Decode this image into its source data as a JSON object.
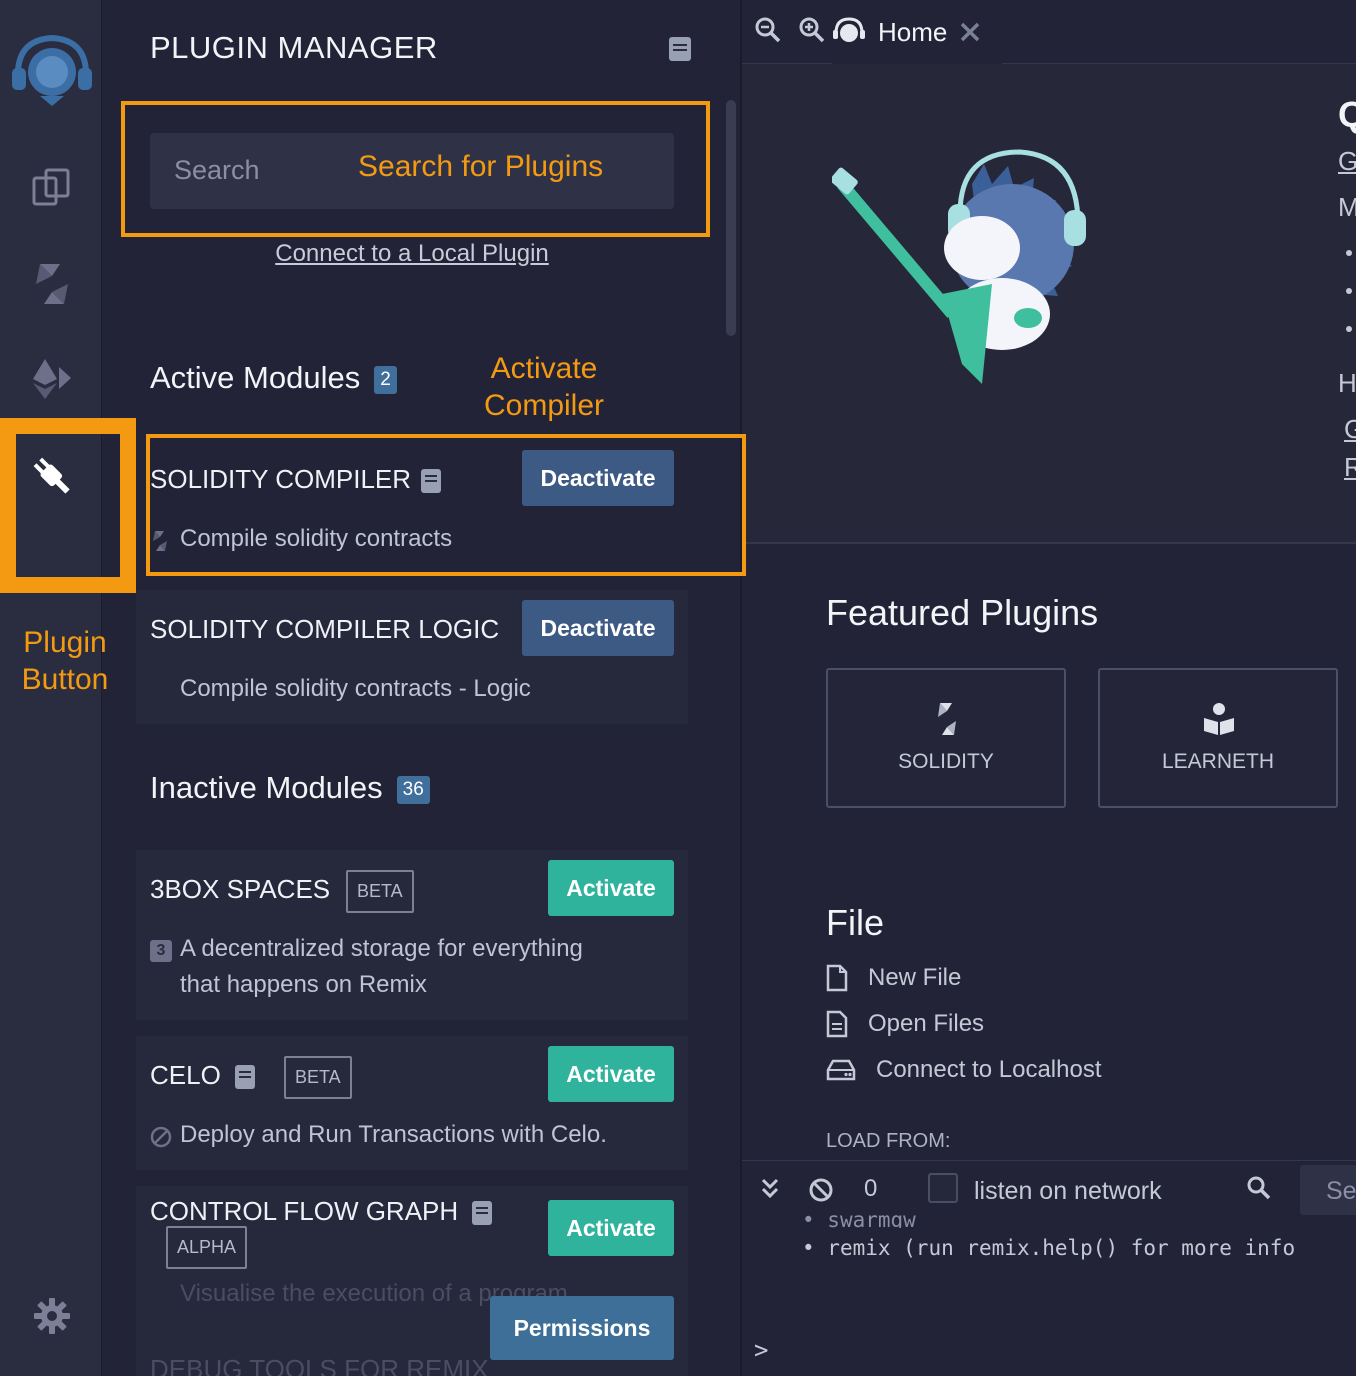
{
  "sidebar": {
    "icons": [
      "remix-logo-icon",
      "file-explorer-icon",
      "solidity-compiler-icon",
      "deploy-run-icon",
      "plugin-icon",
      "settings-icon"
    ]
  },
  "plugin_manager": {
    "title": "PLUGIN MANAGER",
    "search_placeholder": "Search",
    "connect_local_label": "Connect to a Local Plugin",
    "active": {
      "heading": "Active Modules",
      "count": "2",
      "modules": [
        {
          "name": "SOLIDITY COMPILER",
          "description": "Compile solidity contracts",
          "button": "Deactivate"
        },
        {
          "name": "SOLIDITY COMPILER LOGIC",
          "description": "Compile solidity contracts - Logic",
          "button": "Deactivate"
        }
      ]
    },
    "inactive": {
      "heading": "Inactive Modules",
      "count": "36",
      "modules": [
        {
          "name": "3BOX SPACES",
          "tag": "BETA",
          "description_line1": "A decentralized storage for everything",
          "description_line2": "that happens on Remix",
          "button": "Activate"
        },
        {
          "name": "CELO",
          "tag": "BETA",
          "description": "Deploy and Run Transactions with Celo.",
          "button": "Activate"
        },
        {
          "name": "CONTROL FLOW GRAPH",
          "tag": "ALPHA",
          "description": "Visualise the execution of a program",
          "button": "Activate",
          "permissions_button": "Permissions"
        },
        {
          "name": "DEBUG TOOLS FOR REMIX"
        }
      ]
    }
  },
  "home": {
    "tab_label": "Home",
    "hero_letters": {
      "title": "Q",
      "g": "G",
      "m": "M",
      "h": "H",
      "g2": "G",
      "r": "R"
    },
    "featured_title": "Featured Plugins",
    "featured": [
      {
        "label": "SOLIDITY",
        "icon": "solidity-icon"
      },
      {
        "label": "LEARNETH",
        "icon": "book-reader-icon"
      }
    ],
    "file_title": "File",
    "file_items": [
      {
        "label": "New File",
        "icon": "file-icon"
      },
      {
        "label": "Open Files",
        "icon": "file-lines-icon"
      },
      {
        "label": "Connect to Localhost",
        "icon": "hdd-icon"
      }
    ],
    "load_from": "LOAD FROM:"
  },
  "terminal": {
    "count": "0",
    "listen_label": "listen on network",
    "search_partial": "Se",
    "line_partial": "swarmgw",
    "line": "remix (run remix.help() for more info",
    "prompt": ">"
  },
  "annotations": {
    "search_for_plugins": "Search for Plugins",
    "activate_compiler_line1": "Activate",
    "activate_compiler_line2": "Compiler",
    "plugin_button_line1": "Plugin",
    "plugin_button_line2": "Button",
    "color": "#f39a12"
  }
}
